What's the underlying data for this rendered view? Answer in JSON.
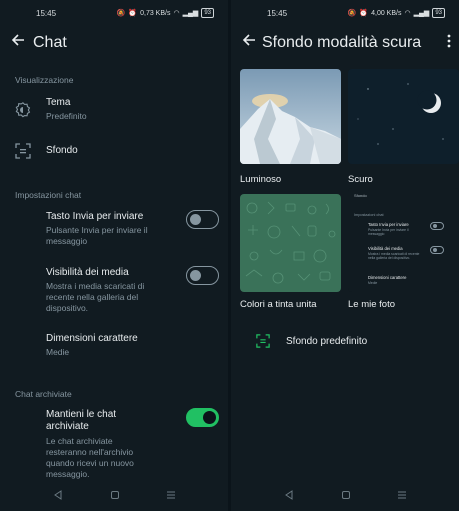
{
  "left": {
    "status": {
      "time": "15:45",
      "net": "0,73 KB/s",
      "battery": "93"
    },
    "title": "Chat",
    "sections": {
      "display": "Visualizzazione",
      "chat_settings": "Impostazioni chat",
      "archived": "Chat archiviate"
    },
    "theme": {
      "title": "Tema",
      "subtitle": "Predefinito"
    },
    "wallpaper": {
      "title": "Sfondo"
    },
    "enter_send": {
      "title": "Tasto Invia per inviare",
      "subtitle": "Pulsante Invia per inviare il messaggio",
      "on": false
    },
    "media_visibility": {
      "title": "Visibilità dei media",
      "subtitle": "Mostra i media scaricati di recente nella galleria del dispositivo.",
      "on": false
    },
    "font_size": {
      "title": "Dimensioni carattere",
      "subtitle": "Medie"
    },
    "keep_archived": {
      "title": "Mantieni le chat archiviate",
      "subtitle": "Le chat archiviate resteranno nell'archivio quando ricevi un nuovo messaggio.",
      "on": true
    }
  },
  "right": {
    "status": {
      "time": "15:45",
      "net": "4,00 KB/s",
      "battery": "93"
    },
    "title": "Sfondo modalità scura",
    "options": {
      "bright": "Luminoso",
      "dark": "Scuro",
      "solid": "Colori a tinta unita",
      "photos": "Le mie foto"
    },
    "default_wallpaper": "Sfondo predefinito",
    "mini_preview": {
      "header": "Sfondo",
      "section": "Impostazioni chat",
      "item1_title": "Tasto Invia per inviare",
      "item1_sub": "Pulsante Invia per inviare il messaggio",
      "item2_title": "Visibilità dei media",
      "item2_sub": "Mostra i media scaricati di recente nella galleria del dispositivo.",
      "item3_title": "Dimensioni carattere",
      "item3_sub": "Medie"
    }
  },
  "colors": {
    "accent": "#21c063",
    "background": "#111b21",
    "secondary_text": "#8696a0"
  }
}
